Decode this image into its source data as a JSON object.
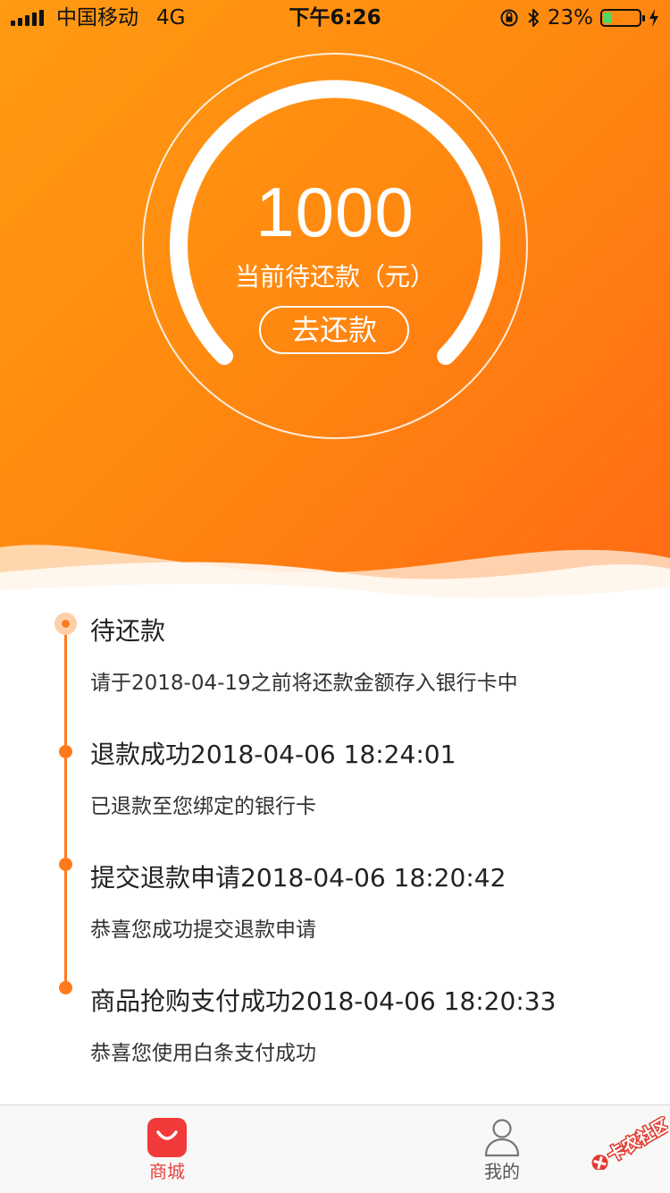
{
  "status_bar": {
    "carrier": "中国移动",
    "network": "4G",
    "time": "下午6:26",
    "battery_percent": "23%",
    "battery_level": 0.23
  },
  "gauge": {
    "amount": "1000",
    "caption": "当前待还款（元）",
    "button_label": "去还款"
  },
  "timeline": [
    {
      "title": "待还款",
      "desc": "请于2018-04-19之前将还款金额存入银行卡中",
      "active": true
    },
    {
      "title": "退款成功2018-04-06 18:24:01",
      "desc": "已退款至您绑定的银行卡",
      "active": false
    },
    {
      "title": "提交退款申请2018-04-06 18:20:42",
      "desc": "恭喜您成功提交退款申请",
      "active": false
    },
    {
      "title": "商品抢购支付成功2018-04-06 18:20:33",
      "desc": "恭喜您使用白条支付成功",
      "active": false
    }
  ],
  "tabbar": {
    "mall_label": "商城",
    "mine_label": "我的"
  },
  "watermark": {
    "text": "卡农社区"
  },
  "colors": {
    "accent": "#ff7a1a",
    "tab_active": "#e8403a",
    "tab_inactive": "#555555"
  }
}
